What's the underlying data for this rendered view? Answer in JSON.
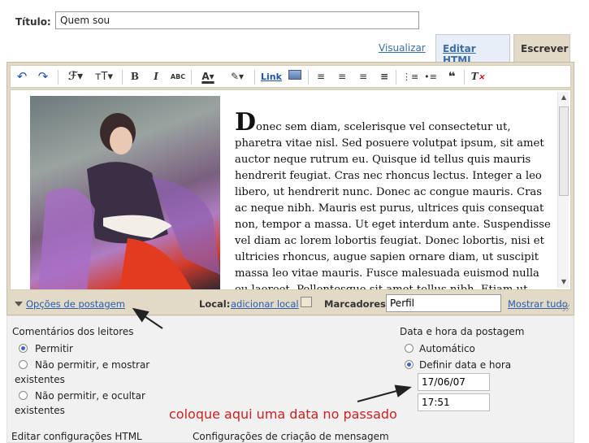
{
  "title_field": {
    "label": "Título:",
    "value": "Quem sou"
  },
  "tabs": {
    "preview": "Visualizar",
    "html": "Editar HTML",
    "compose": "Escrever"
  },
  "toolbar": {
    "undo_icon": "undo-icon",
    "redo_icon": "redo-icon",
    "font": "ℱ",
    "size": "тT",
    "bold": "B",
    "italic": "I",
    "spell": "ABC",
    "text_color": "A",
    "highlight": "✎",
    "link": "Link",
    "icons": [
      "align-left-icon",
      "align-center-icon",
      "align-right-icon",
      "justify-icon",
      "numbered-list-icon",
      "bullet-list-icon",
      "quote-icon",
      "remove-format-icon"
    ]
  },
  "post": {
    "dropcap": "D",
    "body": "onec sem diam, scelerisque vel consectetur ut, pharetra vitae nisl. Sed posuere volutpat ipsum, sit amet auctor neque rutrum eu. Quisque id tellus quis mauris hendrerit feugiat. Cras nec rhoncus lectus. Integer a leo libero, ut hendrerit nunc. Donec ac congue mauris. Cras ac neque nibh. Mauris est purus, ultrices quis consequat non, tempor a massa. Ut eget interdum ante. Suspendisse vel diam ac lorem lobortis feugiat. Donec lobortis, nisi et ultricies rhoncus, augue sapien ornare diam, ut suscipit massa leo vitae mauris. Fusce malesuada euismod nulla eu laoreet. Pellentesque sit amet tellus nibh. Etiam ut cursus justo."
  },
  "options_bar": {
    "post_options": "Opções de postagem",
    "local_label": "Local:",
    "local_link": "adicionar local",
    "tags_label": "Marcadores:",
    "tags_value": "Perfil",
    "show_all": "Mostrar tudo"
  },
  "comments": {
    "title": "Comentários dos leitores",
    "options": [
      "Permitir",
      "Não permitir, e mostrar existentes",
      "Não permitir, e ocultar existentes"
    ],
    "selected": 0
  },
  "datetime": {
    "title": "Data e hora da postagem",
    "auto": "Automático",
    "set": "Definir data e hora",
    "date": "17/06/07",
    "time": "17:51"
  },
  "annotation": "coloque aqui uma data no passado",
  "bottom": {
    "html_settings": "Editar configurações HTML",
    "compose_settings": "Configurações de criação de mensagem"
  },
  "colors": {
    "accent_link": "#2a5db0",
    "annotation": "#d02020",
    "editor_bg": "#e2d9c7"
  }
}
